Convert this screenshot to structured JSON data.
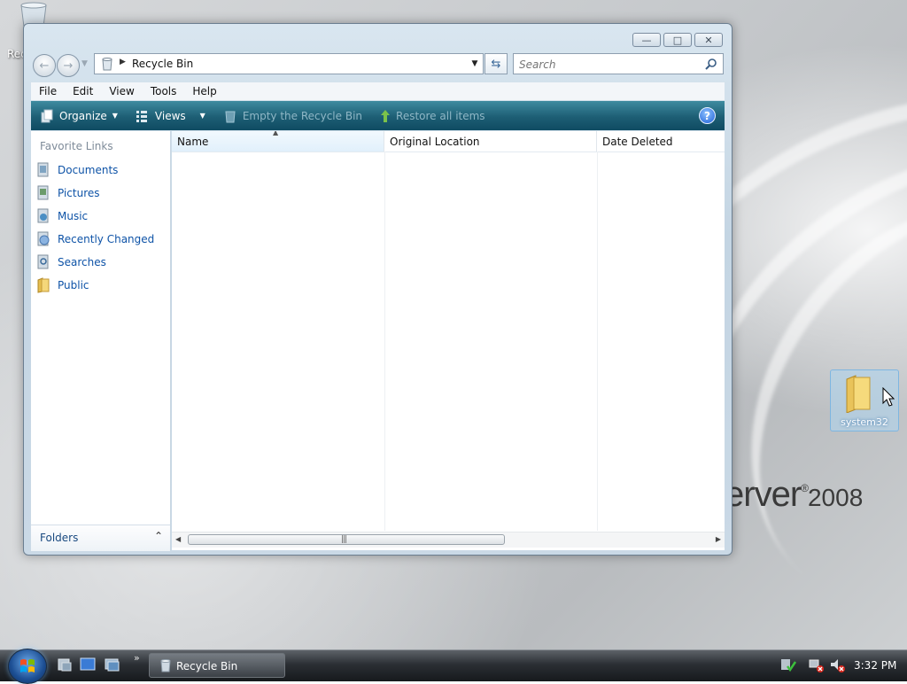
{
  "desktop": {
    "recycle_bin_label": "Rec",
    "brand_text": "erver",
    "brand_mark": "®",
    "brand_year": "2008",
    "folder_label": "system32"
  },
  "window": {
    "address": {
      "location": "Recycle Bin"
    },
    "search": {
      "placeholder": "Search"
    },
    "menu": [
      "File",
      "Edit",
      "View",
      "Tools",
      "Help"
    ],
    "toolbar": {
      "organize": "Organize",
      "views": "Views",
      "empty": "Empty the Recycle Bin",
      "restore": "Restore all items"
    },
    "nav_pane": {
      "header": "Favorite Links",
      "links": [
        "Documents",
        "Pictures",
        "Music",
        "Recently Changed",
        "Searches",
        "Public"
      ],
      "folders_label": "Folders"
    },
    "columns": [
      "Name",
      "Original Location",
      "Date Deleted"
    ]
  },
  "taskbar": {
    "task_label": "Recycle Bin",
    "clock": "3:32 PM"
  },
  "colors": {
    "toolbar": "#1d5e74",
    "link": "#0e53a7",
    "selection": "#add6f0"
  }
}
